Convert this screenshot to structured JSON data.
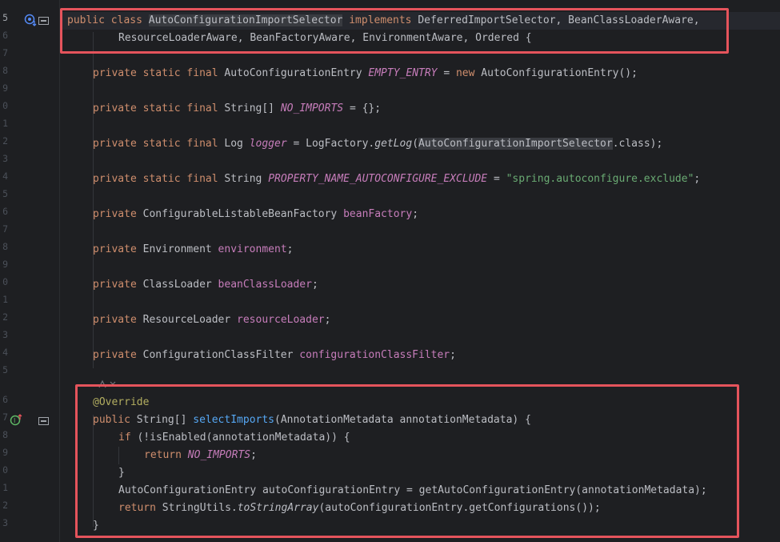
{
  "gutter": {
    "line_numbers": [
      "5",
      "6",
      "7",
      "8",
      "9",
      "0",
      "1",
      "2",
      "3",
      "4",
      "5",
      "6",
      "7",
      "8",
      "9",
      "0",
      "1",
      "2",
      "3",
      "4",
      "5",
      "6",
      "7",
      "8",
      "9",
      "0",
      "1",
      "2",
      "3"
    ]
  },
  "code": {
    "l1_public": "public",
    "l1_class": "class",
    "l1_classname": "AutoConfigurationImportSelector",
    "l1_implements": "implements",
    "l1_rest": "DeferredImportSelector, BeanClassLoaderAware,",
    "l2": "ResourceLoaderAware, BeanFactoryAware, EnvironmentAware, Ordered {",
    "kw_private": "private",
    "kw_static": "static",
    "kw_final": "final",
    "kw_new": "new",
    "kw_public": "public",
    "kw_if": "if",
    "kw_return": "return",
    "f1_type": "AutoConfigurationEntry",
    "f1_name": "EMPTY_ENTRY",
    "f1_eq": " = ",
    "f1_val": "AutoConfigurationEntry();",
    "f2_type": "String[]",
    "f2_name": "NO_IMPORTS",
    "f2_rest": " = {};",
    "f3_type": "Log",
    "f3_name": "logger",
    "f3_a": " = LogFactory.",
    "f3_m": "getLog",
    "f3_b": "(",
    "f3_arg": "AutoConfigurationImportSelector",
    "f3_c": ".class);",
    "f4_type": "String",
    "f4_name": "PROPERTY_NAME_AUTOCONFIGURE_EXCLUDE",
    "f4_eq": " = ",
    "f4_str": "\"spring.autoconfigure.exclude\"",
    "f4_end": ";",
    "f5_type": "ConfigurableListableBeanFactory",
    "f5_name": "beanFactory",
    "f6_type": "Environment",
    "f6_name": "environment",
    "f7_type": "ClassLoader",
    "f7_name": "beanClassLoader",
    "f8_type": "ResourceLoader",
    "f8_name": "resourceLoader",
    "f9_type": "ConfigurationClassFilter",
    "f9_name": "configurationClassFilter",
    "semi": ";",
    "annotation": "@Override",
    "m_type": "String[]",
    "m_name": "selectImports",
    "m_params": "(AnnotationMetadata annotationMetadata) {",
    "if_cond": "(!isEnabled(annotationMetadata)) {",
    "ret_val": "NO_IMPORTS",
    "close_brace": "}",
    "entry_line": "AutoConfigurationEntry autoConfigurationEntry = getAutoConfigurationEntry(annotationMetadata);",
    "ret2_a": "StringUtils.",
    "ret2_m": "toStringArray",
    "ret2_b": "(autoConfigurationEntry.getConfigurations());"
  },
  "icons": {
    "class_gutter": "implementation-marker-icon",
    "class_hide": "hide-code-icon",
    "method_gutter": "override-marker-icon",
    "method_hide": "hide-code-icon",
    "ai_hint": "ai-assistant-hint-icon"
  },
  "colors": {
    "highlight_box": "#e5545c",
    "background": "#1e1f22",
    "keyword": "#cf8e6d",
    "field": "#c77dbb",
    "string": "#6aab73"
  }
}
